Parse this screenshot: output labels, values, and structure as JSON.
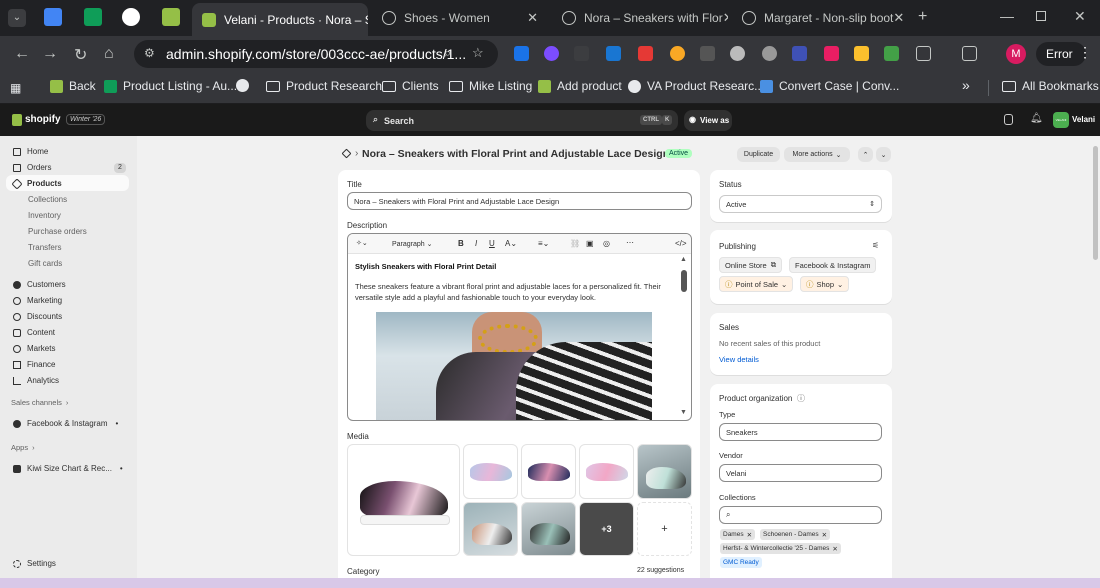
{
  "browser": {
    "tabs": [
      {
        "title": "Velani - Products · Nora – Sn",
        "active": true
      },
      {
        "title": "Shoes - Women",
        "active": false
      },
      {
        "title": "Nora – Sneakers with Flor",
        "active": false
      },
      {
        "title": "Margaret - Non-slip boot",
        "active": false
      }
    ],
    "new_tab": "+",
    "address": "admin.shopify.com/store/003ccc-ae/products/1...",
    "profile_initial": "M",
    "error_label": "Error",
    "bookmarks": [
      "Back",
      "Product Listing - Au...",
      "Product Research",
      "Clients",
      "Mike Listing",
      "Add product",
      "VA Product Researc...",
      "Convert Case | Conv..."
    ],
    "all_bookmarks": "All Bookmarks",
    "more": "»"
  },
  "shopify": {
    "logo": "shopify",
    "edition": "Winter '26",
    "search_placeholder": "Search",
    "kbd_ctrl": "CTRL",
    "kbd_k": "K",
    "view_as": "View as",
    "store_name": "Velani",
    "store_badge": "VELANI"
  },
  "sidebar": {
    "items": [
      {
        "label": "Home"
      },
      {
        "label": "Orders",
        "badge": "2"
      },
      {
        "label": "Products"
      },
      {
        "label": "Customers"
      },
      {
        "label": "Marketing"
      },
      {
        "label": "Discounts"
      },
      {
        "label": "Content"
      },
      {
        "label": "Markets"
      },
      {
        "label": "Finance"
      },
      {
        "label": "Analytics"
      }
    ],
    "product_sub": [
      "Collections",
      "Inventory",
      "Purchase orders",
      "Transfers",
      "Gift cards"
    ],
    "sales_channels": "Sales channels",
    "channel": "Facebook & Instagram",
    "apps": "Apps",
    "app": "Kiwi Size Chart & Rec...",
    "settings": "Settings"
  },
  "page": {
    "title": "Nora – Sneakers with Floral Print and Adjustable Lace Design",
    "status_badge": "Active",
    "duplicate": "Duplicate",
    "more_actions": "More actions",
    "title_label": "Title",
    "title_value": "Nora – Sneakers with Floral Print and Adjustable Lace Design",
    "description_label": "Description",
    "paragraph": "Paragraph",
    "desc_heading": "Stylish Sneakers with Floral Print Detail",
    "desc_body": "These sneakers feature a vibrant floral print and adjustable laces for a personalized fit. Their versatile style add a playful and fashionable touch to your everyday look.",
    "media_label": "Media",
    "media_more": "+3",
    "media_add": "+",
    "category_label": "Category",
    "suggestions": "22 suggestions"
  },
  "right": {
    "status_label": "Status",
    "status_value": "Active",
    "publishing_label": "Publishing",
    "channels": [
      "Online Store",
      "Facebook & Instagram"
    ],
    "warn_channels": [
      "Point of Sale",
      "Shop"
    ],
    "sales_label": "Sales",
    "sales_text": "No recent sales of this product",
    "view_details": "View details",
    "org_label": "Product organization",
    "type_label": "Type",
    "type_value": "Sneakers",
    "vendor_label": "Vendor",
    "vendor_value": "Velani",
    "collections_label": "Collections",
    "collection_tags": [
      "Dames",
      "Schoenen - Dames",
      "Herfst- & Wintercollectie '25 - Dames"
    ],
    "gmc_tag": "GMC Ready"
  },
  "colors": {
    "accent": "#1a1a1a",
    "badge": "#affebf",
    "link": "#005bd3"
  }
}
